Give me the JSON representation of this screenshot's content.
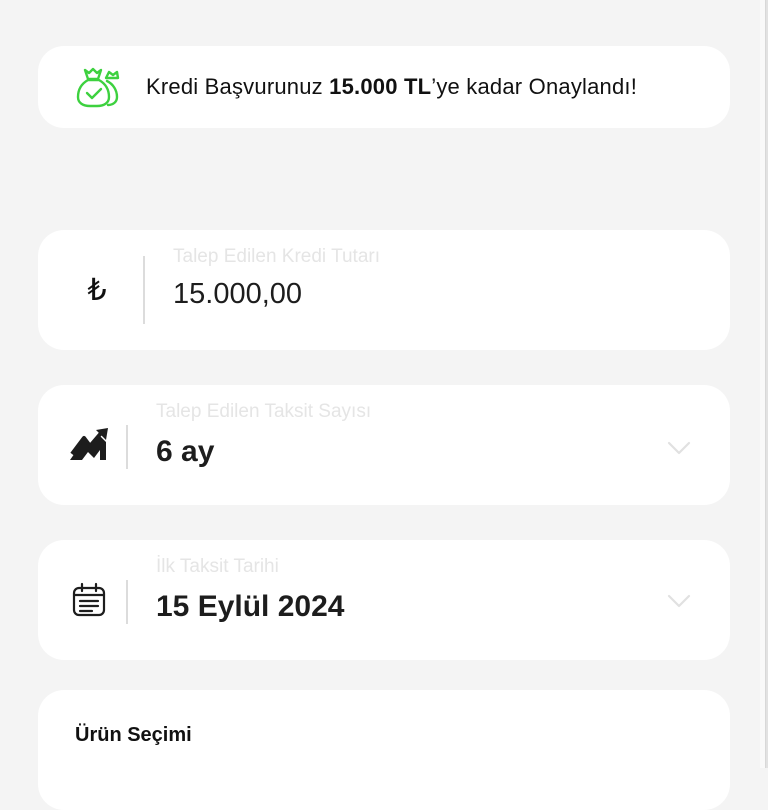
{
  "banner": {
    "icon": "money-bags-check-icon",
    "text_before": "Kredi Başvurunuz ",
    "amount": "15.000 TL",
    "text_after": "’ye kadar Onaylandı!"
  },
  "fields": {
    "amount": {
      "icon": "lira-icon",
      "icon_glyph": "₺",
      "label": "Talep Edilen Kredi Tutarı",
      "value": "15.000,00"
    },
    "installments": {
      "icon": "trend-chart-icon",
      "label": "Talep Edilen Taksit Sayısı",
      "value": "6 ay"
    },
    "first_date": {
      "icon": "calendar-icon",
      "label": "İlk Taksit Tarihi",
      "value": "15 Eylül 2024"
    }
  },
  "product": {
    "title": "Ürün Seçimi"
  },
  "colors": {
    "accent_green": "#3dd13f",
    "background": "#f4f4f4",
    "card": "#ffffff"
  }
}
